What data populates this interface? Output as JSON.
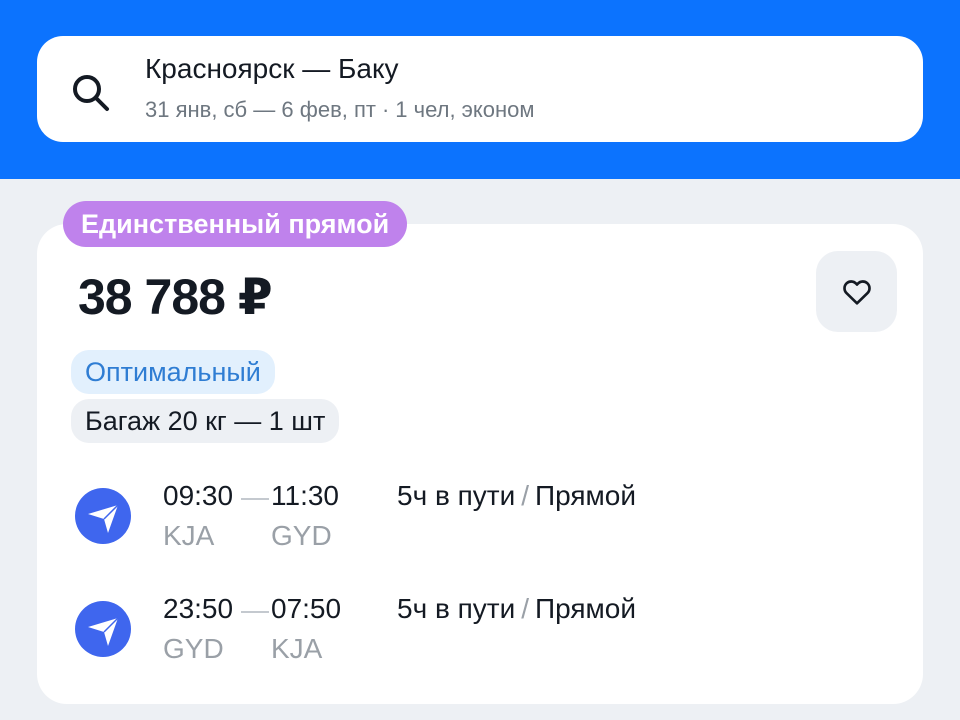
{
  "search": {
    "route": "Красноярск — Баку",
    "dates": "31 янв, сб — 6 фев, пт",
    "separator": "·",
    "passengers": "1 чел, эконом"
  },
  "offer": {
    "badge": "Единственный прямой",
    "price": "38 788 ₽",
    "tags": {
      "optimal": "Оптимальный",
      "baggage": "Багаж 20 кг — 1 шт"
    }
  },
  "segments": [
    {
      "dep_time": "09:30",
      "arr_time": "11:30",
      "dep_iata": "KJA",
      "arr_iata": "GYD",
      "duration": "5ч в пути",
      "slash": "/",
      "stops": "Прямой"
    },
    {
      "dep_time": "23:50",
      "arr_time": "07:50",
      "dep_iata": "GYD",
      "arr_iata": "KJA",
      "duration": "5ч в пути",
      "slash": "/",
      "stops": "Прямой"
    }
  ],
  "icons": {
    "search": "search-icon",
    "favorite": "heart-icon",
    "airline": "paper-plane-icon"
  },
  "colors": {
    "header": "#0C73FE",
    "badge": "#BF82EC",
    "airline_logo": "#3F66EE",
    "optimal_tag_text": "#2F7DD3"
  }
}
